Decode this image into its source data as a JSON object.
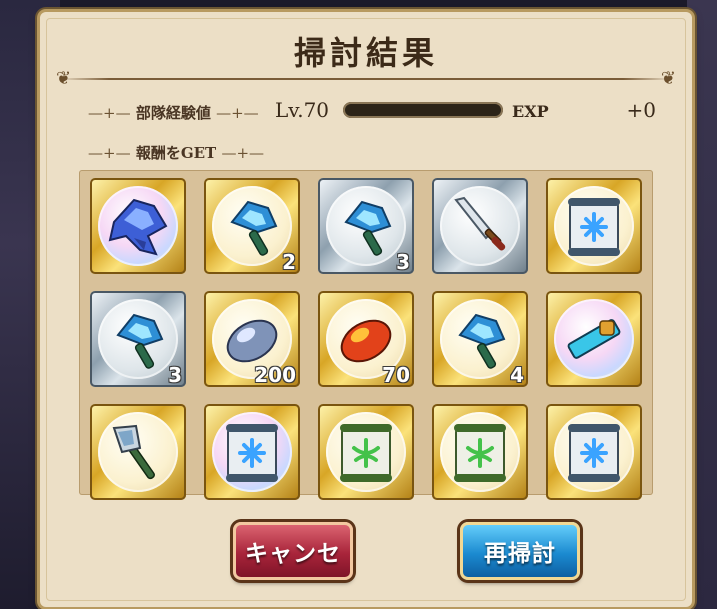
{
  "dialog": {
    "title": "掃討結果",
    "party_exp_label": "部隊経験値",
    "level": "Lv.70",
    "exp_progress": 0.0,
    "exp_label": "EXP",
    "exp_gain": "+0",
    "rewards_label": "報酬をGET"
  },
  "rewards": [
    {
      "icon": "blue-crystal-ore-large-icon",
      "frame": "gold",
      "quantity": ""
    },
    {
      "icon": "blue-crystal-ore-icon",
      "frame": "gold",
      "quantity": "2"
    },
    {
      "icon": "blue-crystal-ore-icon",
      "frame": "silver",
      "quantity": "3"
    },
    {
      "icon": "dagger-icon",
      "frame": "silver",
      "quantity": ""
    },
    {
      "icon": "blue-rune-scroll-icon",
      "frame": "gold",
      "quantity": ""
    },
    {
      "icon": "blue-crystal-ore-icon",
      "frame": "silver",
      "quantity": "3"
    },
    {
      "icon": "silver-seed-icon",
      "frame": "gold",
      "quantity": "200"
    },
    {
      "icon": "fire-seed-icon",
      "frame": "gold",
      "quantity": "70"
    },
    {
      "icon": "blue-crystal-ore-icon",
      "frame": "gold",
      "quantity": "4"
    },
    {
      "icon": "energy-cell-icon",
      "frame": "gold",
      "quantity": ""
    },
    {
      "icon": "battle-axe-icon",
      "frame": "gold",
      "quantity": ""
    },
    {
      "icon": "blue-rune-scroll-icon",
      "frame": "gold",
      "quantity": ""
    },
    {
      "icon": "green-rune-scroll-icon",
      "frame": "gold",
      "quantity": ""
    },
    {
      "icon": "green-rune-scroll-icon",
      "frame": "gold",
      "quantity": ""
    },
    {
      "icon": "blue-rune-scroll-icon",
      "frame": "gold",
      "quantity": ""
    }
  ],
  "buttons": {
    "cancel": "キャンセ",
    "resweep": "再掃討"
  },
  "colors": {
    "panel": "#ecdfc6",
    "cancel_button": "#a8243a",
    "resweep_button": "#1b8ad0",
    "gold_frame": "#d8a626",
    "silver_frame": "#8ea0ae"
  }
}
